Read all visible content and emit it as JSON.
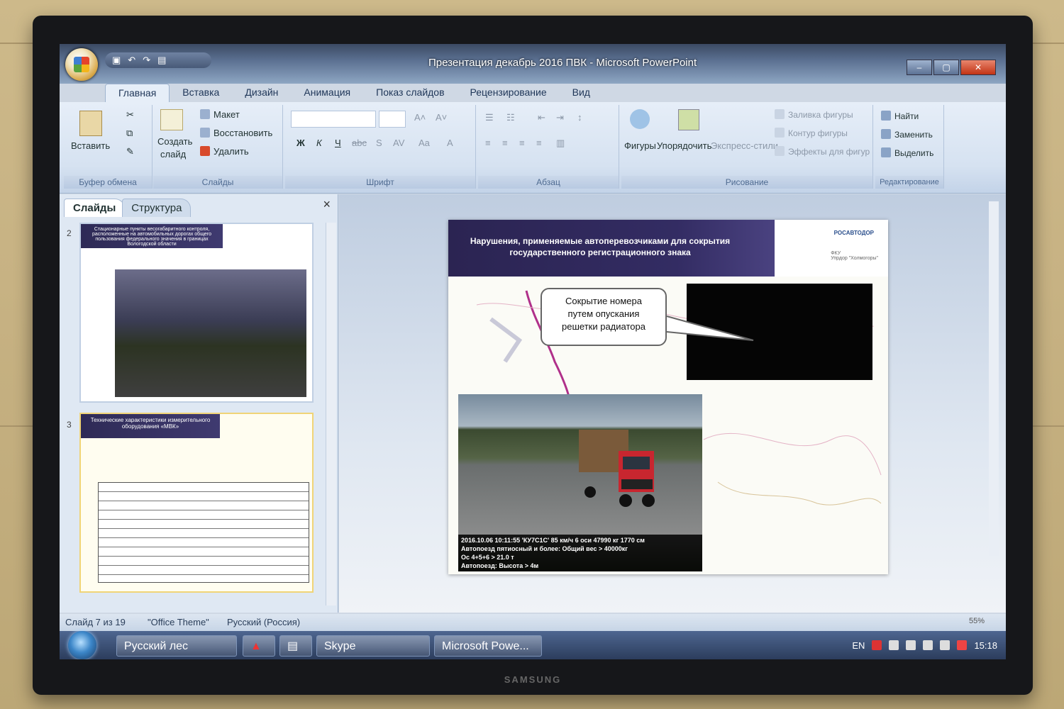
{
  "window": {
    "title": "Презентация декабрь 2016 ПВК - Microsoft PowerPoint"
  },
  "ribbon_tabs": [
    "Главная",
    "Вставка",
    "Дизайн",
    "Анимация",
    "Показ слайдов",
    "Рецензирование",
    "Вид"
  ],
  "clipboard": {
    "paste": "Вставить",
    "label": "Буфер обмена"
  },
  "slides_group": {
    "new_slide_1": "Создать",
    "new_slide_2": "слайд",
    "layout": "Макет",
    "reset": "Восстановить",
    "delete": "Удалить",
    "label": "Слайды"
  },
  "font_group": {
    "label": "Шрифт",
    "bold": "Ж",
    "italic": "К",
    "underline": "Ч",
    "strike": "abc",
    "shadow": "S",
    "spacing": "AV",
    "case": "Aa",
    "color": "A"
  },
  "paragraph_group": {
    "label": "Абзац"
  },
  "drawing_group": {
    "label": "Рисование",
    "shapes": "Фигуры",
    "arrange": "Упорядочить",
    "quick_styles": "Экспресс-стили",
    "fill": "Заливка фигуры",
    "outline": "Контур фигуры",
    "effects": "Эффекты для фигур"
  },
  "editing_group": {
    "label": "Редактирование",
    "find": "Найти",
    "replace": "Заменить",
    "select": "Выделить"
  },
  "panel": {
    "tab_slides": "Слайды",
    "tab_outline": "Структура",
    "close": "×"
  },
  "thumbnails": [
    {
      "num": "2",
      "title": "Стационарные пункты весогабаритного контроля, расположенные на автомобильных дорогах общего пользования федерального значения в границах Вологодской области"
    },
    {
      "num": "3",
      "title": "Технические характеристики измерительного оборудования «МВК»"
    }
  ],
  "slide": {
    "title": "Нарушения, применяемые автоперевозчиками для сокрытия государственного регистрационного знака",
    "logo": "РОСАВТОДОР",
    "logo2_a": "ФКУ",
    "logo2_b": "Упрдор \"Холмогоры\"",
    "callout_1": "Сокрытие номера",
    "callout_2": "путем опускания",
    "callout_3": "решетки радиатора",
    "caption_1": "2016.10.06 10:11:55 'КУ7С1С' 85 км/ч 6 оси 47990 кг 1770 см",
    "caption_2": "Автопоезд пятиосный и более: Общий вес > 40000кг",
    "caption_3": "Ос 4+5+6 > 21.0 т",
    "caption_4": "Автопоезд: Высота > 4м"
  },
  "status": {
    "slide_count": "Слайд 7 из 19",
    "theme": "\"Office Theme\"",
    "language": "Русский (Россия)",
    "zoom": "55%"
  },
  "taskbar": {
    "item1": "Русский лес",
    "item2": "Skype",
    "item3": "Microsoft Powe..."
  },
  "tray": {
    "lang": "EN",
    "time": "15:18"
  },
  "tv_brand": "SAMSUNG"
}
